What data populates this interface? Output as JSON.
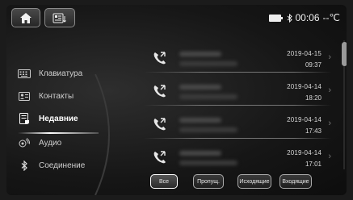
{
  "status": {
    "clock": "00:06",
    "temperature": "--℃"
  },
  "sidebar": {
    "items": [
      {
        "label": "Клавиатура",
        "icon": "keypad-icon"
      },
      {
        "label": "Контакты",
        "icon": "contacts-icon"
      },
      {
        "label": "Недавние",
        "icon": "recent-calls-icon",
        "active": true
      },
      {
        "label": "Аудио",
        "icon": "audio-icon"
      },
      {
        "label": "Соединение",
        "icon": "bluetooth-icon"
      }
    ]
  },
  "calls": [
    {
      "date": "2019-04-15",
      "time": "09:37"
    },
    {
      "date": "2019-04-14",
      "time": "18:20"
    },
    {
      "date": "2019-04-14",
      "time": "17:43"
    },
    {
      "date": "2019-04-14",
      "time": "17:01"
    }
  ],
  "tabs": [
    {
      "label": "Все",
      "active": true
    },
    {
      "label": "Пропущ."
    },
    {
      "label": "Исходящие"
    },
    {
      "label": "Входящие"
    }
  ],
  "colors": {
    "accent": "#ffffff",
    "background": "#161616"
  }
}
